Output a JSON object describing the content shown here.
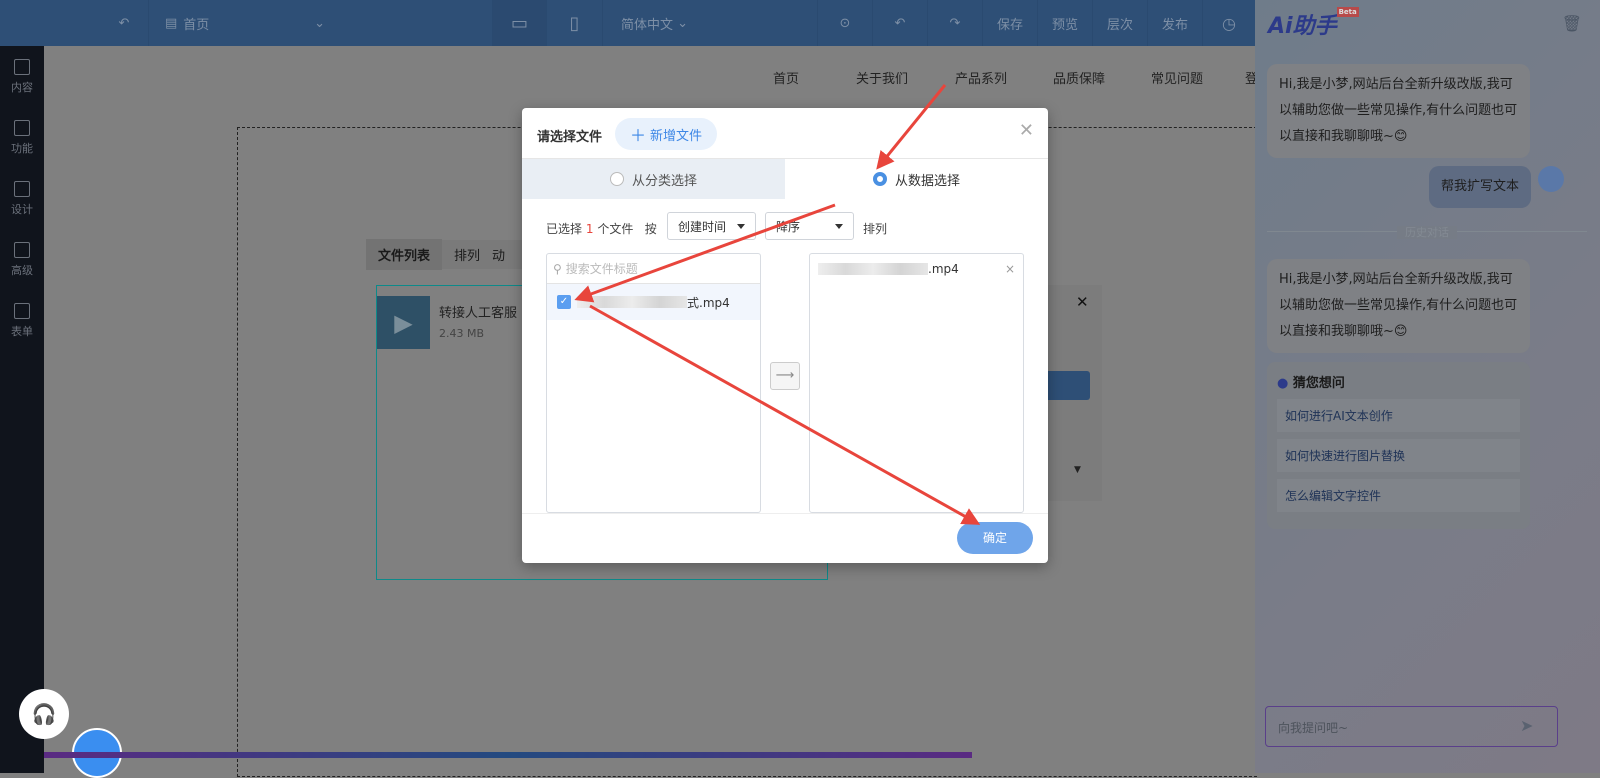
{
  "topbar": {
    "page": "首页",
    "lang": "简体中文",
    "save": "保存",
    "preview": "预览",
    "layers": "层次",
    "publish": "发布"
  },
  "sidebar": [
    {
      "label": "内容"
    },
    {
      "label": "功能"
    },
    {
      "label": "设计"
    },
    {
      "label": "高级"
    },
    {
      "label": "表单"
    }
  ],
  "site_nav": [
    "首页",
    "关于我们",
    "产品系列",
    "品质保障",
    "常见问题",
    "登"
  ],
  "component_toolbar": {
    "file_list": "文件列表",
    "arrange": "排列",
    "anim": "动"
  },
  "file_item": {
    "name": "转接人工客服",
    "size": "2.43 MB"
  },
  "modal": {
    "title": "请选择文件",
    "add_button": "新增文件",
    "tab_category": "从分类选择",
    "tab_data": "从数据选择",
    "selected_prefix": "已选择",
    "selected_count": "1",
    "selected_suffix": "个文件",
    "by": "按",
    "sort_field": "创建时间",
    "sort_order": "降序",
    "sort_suffix": "排列",
    "search_placeholder": "搜索文件标题",
    "left_file": "式.mp4",
    "right_file": ".mp4",
    "confirm": "确定"
  },
  "ai": {
    "logo": "Ai助手",
    "beta": "Beta",
    "greeting": "Hi,我是小梦,网站后台全新升级改版,我可以辅助您做一些常见操作,有什么问题也可以直接和我聊聊哦~😊",
    "user_msg": "帮我扩写文本",
    "history": "历史对话",
    "guess_title": "猜您想问",
    "suggestions": [
      "如何进行AI文本创作",
      "如何快速进行图片替换",
      "怎么编辑文字控件"
    ],
    "input_placeholder": "向我提问吧~"
  },
  "colors": {
    "accent": "#5b9ef0",
    "arrow": "#e8453c"
  }
}
